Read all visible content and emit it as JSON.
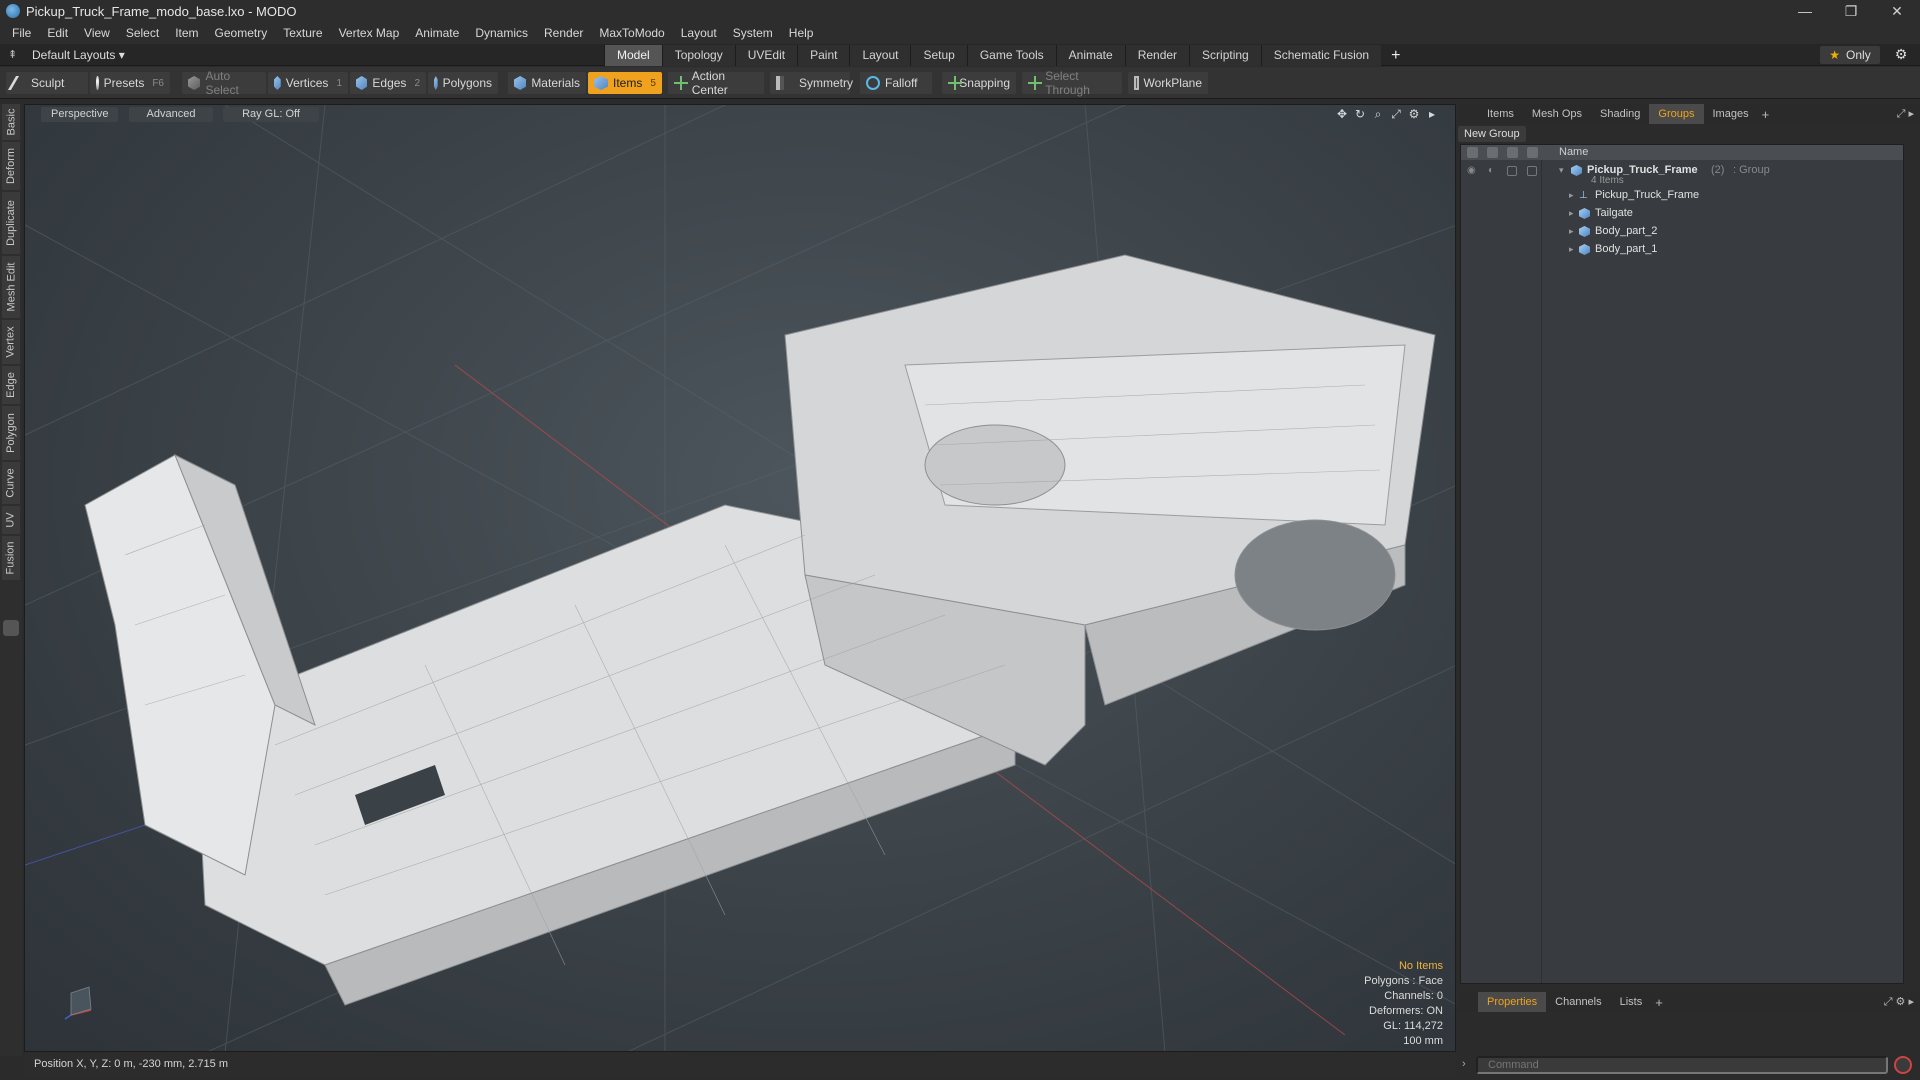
{
  "window": {
    "title": "Pickup_Truck_Frame_modo_base.lxo - MODO",
    "controls": [
      "—",
      "❐",
      "✕"
    ]
  },
  "menu": [
    "File",
    "Edit",
    "View",
    "Select",
    "Item",
    "Geometry",
    "Texture",
    "Vertex Map",
    "Animate",
    "Dynamics",
    "Render",
    "MaxToModo",
    "Layout",
    "System",
    "Help"
  ],
  "layout": {
    "selector": "Default Layouts ▾",
    "tabs": [
      "Model",
      "Topology",
      "UVEdit",
      "Paint",
      "Layout",
      "Setup",
      "Game Tools",
      "Animate",
      "Render",
      "Scripting",
      "Schematic Fusion"
    ],
    "active_tab": "Model",
    "plus": "+",
    "only_label": "Only"
  },
  "toolbar": {
    "sculpt": "Sculpt",
    "presets": "Presets",
    "presets_key": "F6",
    "auto_select": "Auto Select",
    "vertices": "Vertices",
    "vertices_key": "1",
    "edges": "Edges",
    "edges_key": "2",
    "polygons": "Polygons",
    "materials": "Materials",
    "items": "Items",
    "items_key": "5",
    "action_center": "Action Center",
    "symmetry": "Symmetry",
    "falloff": "Falloff",
    "snapping": "Snapping",
    "select_through": "Select Through",
    "workplane": "WorkPlane"
  },
  "left_tabs": [
    "Basic",
    "Deform",
    "Duplicate",
    "Mesh Edit",
    "Vertex",
    "Edge",
    "Polygon",
    "Curve",
    "UV",
    "Fusion"
  ],
  "viewport": {
    "view": "Perspective",
    "shading": "Advanced",
    "raygl": "Ray GL: Off",
    "stats": {
      "no_items": "No Items",
      "polygons": "Polygons : Face",
      "channels": "Channels: 0",
      "deformers": "Deformers: ON",
      "gl": "GL: 114,272",
      "scale": "100 mm"
    }
  },
  "status": "Position X, Y, Z:  0 m, -230 mm, 2.715 m",
  "right_panel": {
    "tabs": [
      "Items",
      "Mesh Ops",
      "Shading",
      "Groups",
      "Images"
    ],
    "active_tab": "Groups",
    "new_group": "New Group",
    "col_name": "Name",
    "group": {
      "name": "Pickup_Truck_Frame",
      "count": "(2)",
      "type": ": Group",
      "sub": "4 Items"
    },
    "children": [
      "Pickup_Truck_Frame",
      "Tailgate",
      "Body_part_2",
      "Body_part_1"
    ],
    "bottom_tabs": [
      "Properties",
      "Channels",
      "Lists"
    ],
    "bottom_active": "Properties",
    "command_placeholder": "Command"
  },
  "colors": {
    "accent": "#f0a21e",
    "viewport_bg": "#3a4147"
  }
}
